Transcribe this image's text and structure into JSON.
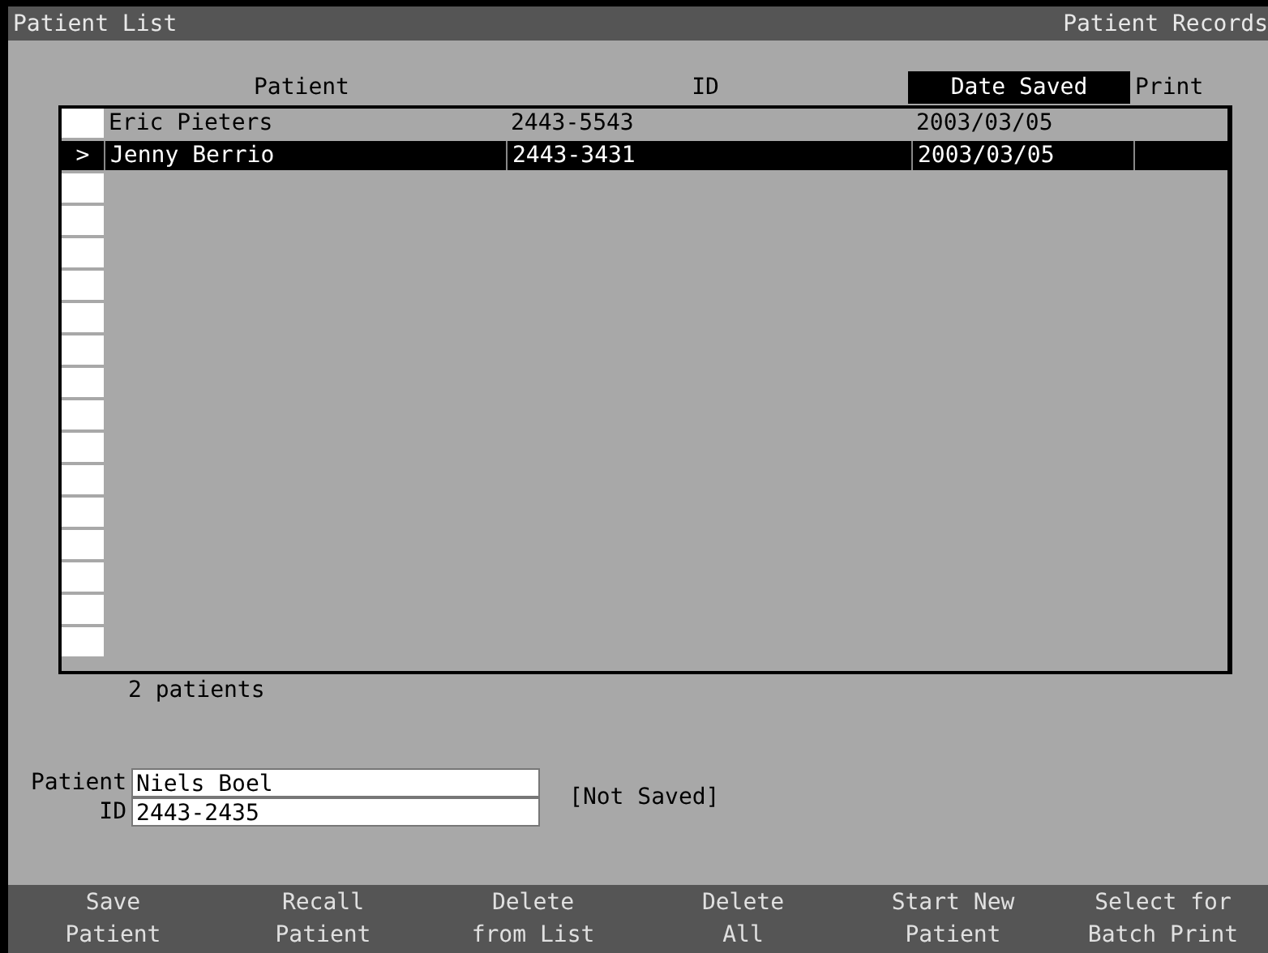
{
  "window": {
    "title": "Patient List",
    "section": "Patient Records"
  },
  "table": {
    "columns": [
      {
        "label": "Patient",
        "sorted": false
      },
      {
        "label": "ID",
        "sorted": false
      },
      {
        "label": "Date Saved",
        "sorted": true
      },
      {
        "label": "Print",
        "sorted": false
      }
    ],
    "rows": [
      {
        "marker": "",
        "patient": "Eric Pieters",
        "id": "2443-5543",
        "date_saved": "2003/03/05",
        "selected": false
      },
      {
        "marker": ">",
        "patient": "Jenny Berrio",
        "id": "2443-3431",
        "date_saved": "2003/03/05",
        "selected": true
      }
    ]
  },
  "count": "2 patients",
  "form": {
    "patient_label": "Patient",
    "patient_value": "Niels Boel",
    "id_label": "ID",
    "id_value": "2443-2435",
    "status": "[Not Saved]"
  },
  "buttons": [
    [
      "Save",
      "Patient"
    ],
    [
      "Recall",
      "Patient"
    ],
    [
      "Delete",
      "from List"
    ],
    [
      "Delete",
      "All"
    ],
    [
      "Start New",
      "Patient"
    ],
    [
      "Select for",
      "Batch Print"
    ]
  ]
}
